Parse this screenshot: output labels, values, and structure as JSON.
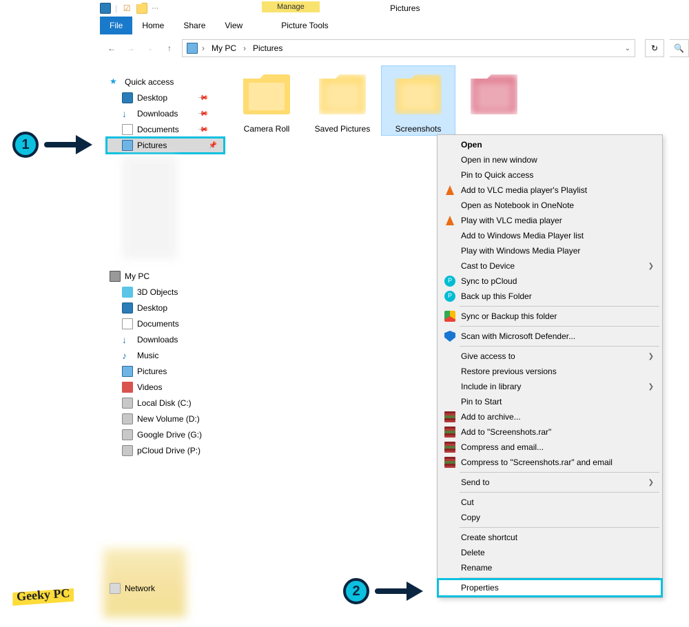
{
  "window": {
    "title": "Pictures"
  },
  "qat": {
    "manage": "Manage",
    "picture_tools": "Picture Tools"
  },
  "ribbon": {
    "file": "File",
    "home": "Home",
    "share": "Share",
    "view": "View"
  },
  "breadcrumb": {
    "root": "My PC",
    "current": "Pictures"
  },
  "sidebar": {
    "quick_access": "Quick access",
    "qa_items": [
      {
        "label": "Desktop"
      },
      {
        "label": "Downloads"
      },
      {
        "label": "Documents"
      },
      {
        "label": "Pictures"
      }
    ],
    "my_pc": "My PC",
    "pc_items": [
      {
        "label": "3D Objects"
      },
      {
        "label": "Desktop"
      },
      {
        "label": "Documents"
      },
      {
        "label": "Downloads"
      },
      {
        "label": "Music"
      },
      {
        "label": "Pictures"
      },
      {
        "label": "Videos"
      },
      {
        "label": "Local Disk (C:)"
      },
      {
        "label": "New Volume (D:)"
      },
      {
        "label": "Google Drive (G:)"
      },
      {
        "label": "pCloud Drive (P:)"
      }
    ],
    "network": "Network"
  },
  "folders": [
    {
      "label": "Camera Roll"
    },
    {
      "label": "Saved Pictures"
    },
    {
      "label": "Screenshots"
    },
    {
      "label": ""
    }
  ],
  "context_menu": [
    {
      "label": "Open",
      "bold": true
    },
    {
      "label": "Open in new window"
    },
    {
      "label": "Pin to Quick access"
    },
    {
      "label": "Add to VLC media player's Playlist",
      "icon": "vlc"
    },
    {
      "label": "Open as Notebook in OneNote"
    },
    {
      "label": "Play with VLC media player",
      "icon": "vlc"
    },
    {
      "label": "Add to Windows Media Player list"
    },
    {
      "label": "Play with Windows Media Player"
    },
    {
      "label": "Cast to Device",
      "submenu": true
    },
    {
      "label": "Sync to pCloud",
      "icon": "pcloud"
    },
    {
      "label": "Back up this Folder",
      "icon": "pcloud"
    },
    {
      "sep": true
    },
    {
      "label": "Sync or Backup this folder",
      "icon": "gdrive"
    },
    {
      "sep": true
    },
    {
      "label": "Scan with Microsoft Defender...",
      "icon": "shield"
    },
    {
      "sep": true
    },
    {
      "label": "Give access to",
      "submenu": true
    },
    {
      "label": "Restore previous versions"
    },
    {
      "label": "Include in library",
      "submenu": true
    },
    {
      "label": "Pin to Start"
    },
    {
      "label": "Add to archive...",
      "icon": "rar"
    },
    {
      "label": "Add to \"Screenshots.rar\"",
      "icon": "rar"
    },
    {
      "label": "Compress and email...",
      "icon": "rar"
    },
    {
      "label": "Compress to \"Screenshots.rar\" and email",
      "icon": "rar"
    },
    {
      "sep": true
    },
    {
      "label": "Send to",
      "submenu": true
    },
    {
      "sep": true
    },
    {
      "label": "Cut"
    },
    {
      "label": "Copy"
    },
    {
      "sep": true
    },
    {
      "label": "Create shortcut"
    },
    {
      "label": "Delete"
    },
    {
      "label": "Rename"
    },
    {
      "sep": true
    },
    {
      "label": "Properties",
      "highlight": true
    }
  ],
  "watermark": "Geeky PC",
  "callouts": {
    "one": "1",
    "two": "2"
  }
}
